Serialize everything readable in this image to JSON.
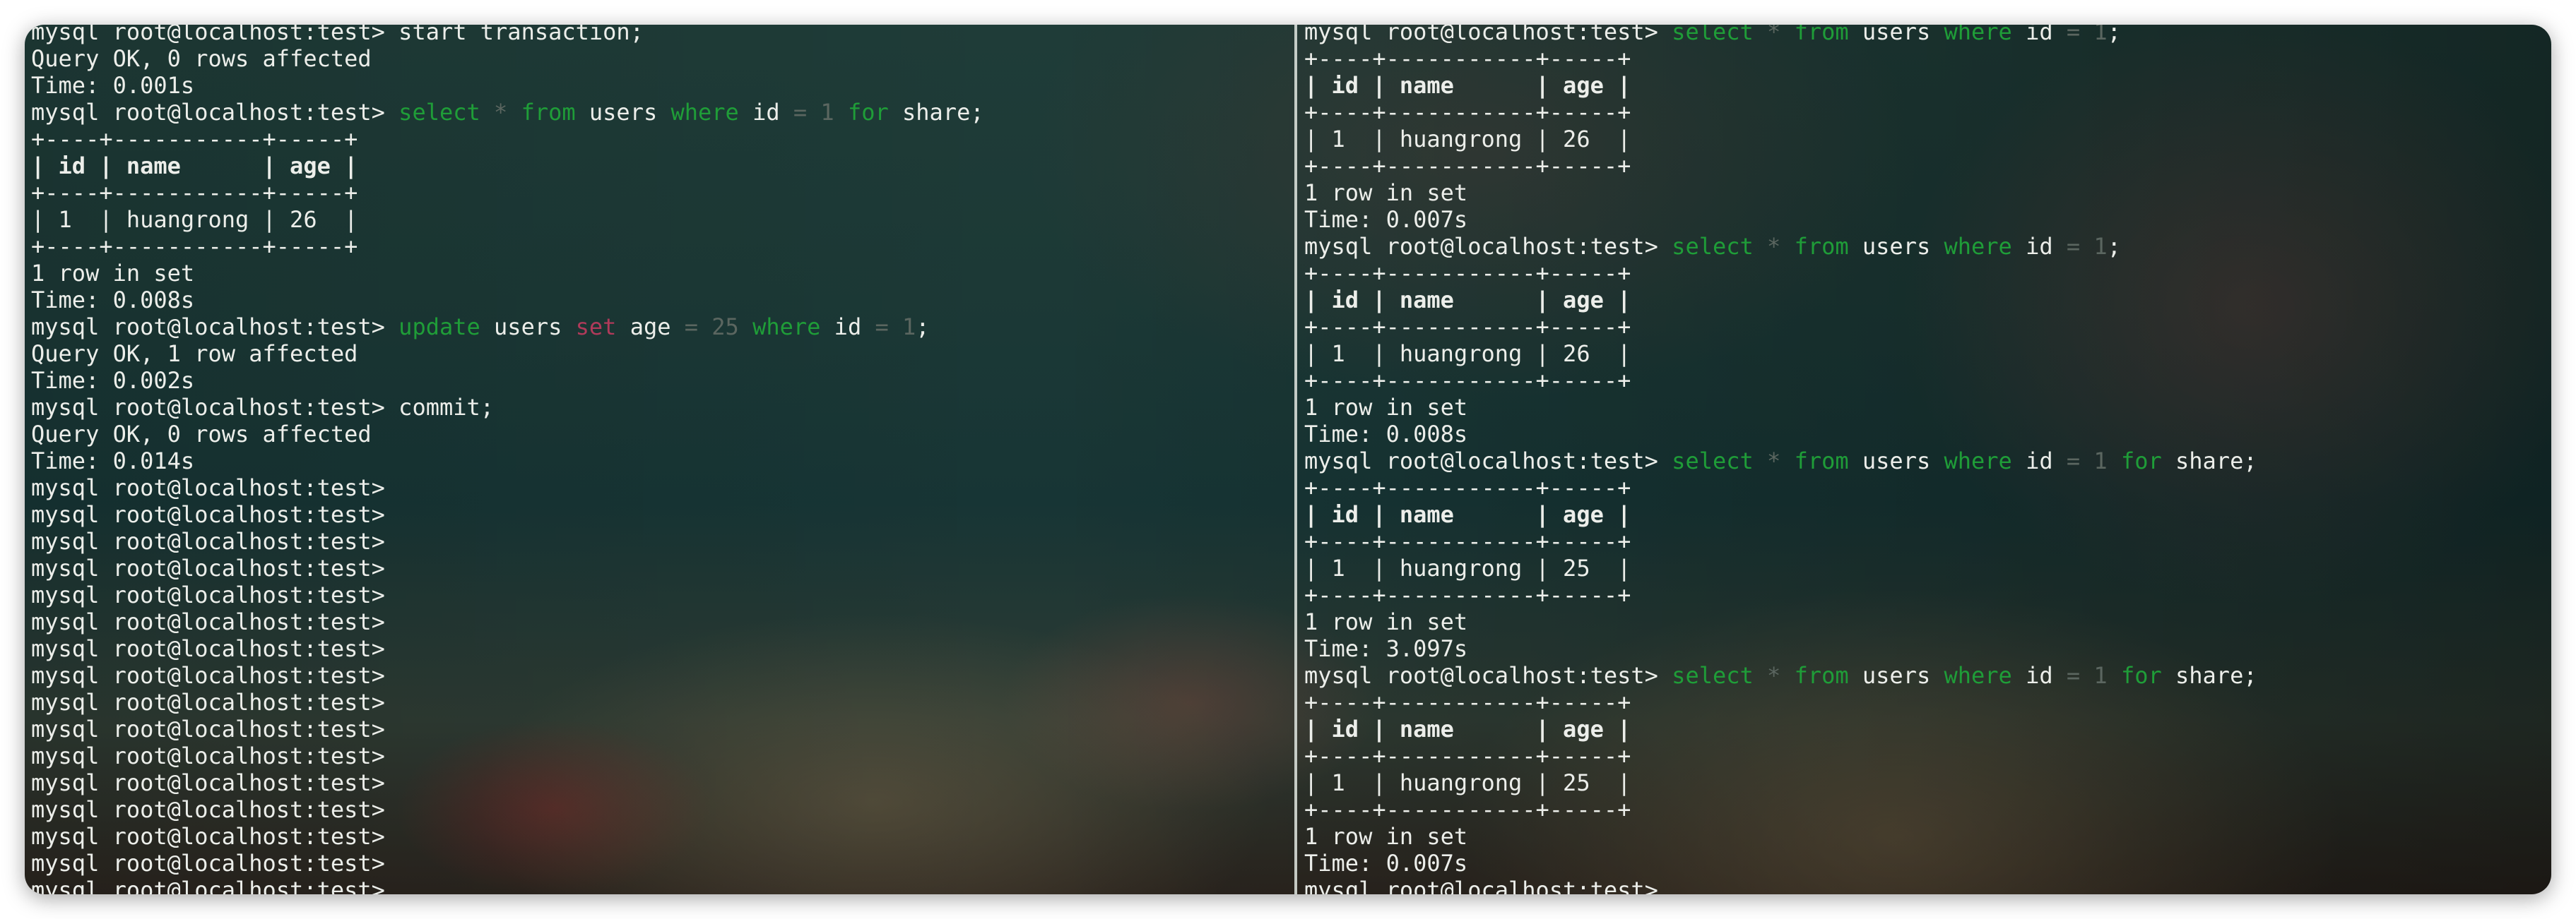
{
  "colors": {
    "keyword": "#1f9d38",
    "operator": "#5b6660",
    "set_keyword": "#b03a5a",
    "text": "#eceeea"
  },
  "left_pane": {
    "lines": [
      {
        "type": "cmd",
        "prompt": "mysql root@localhost:test> ",
        "tokens": [
          {
            "t": "start transaction;",
            "c": ""
          }
        ]
      },
      {
        "type": "out",
        "text": "Query OK, 0 rows affected"
      },
      {
        "type": "out",
        "text": "Time: 0.001s"
      },
      {
        "type": "cmd",
        "prompt": "mysql root@localhost:test> ",
        "tokens": [
          {
            "t": "select",
            "c": "kw"
          },
          {
            "t": " "
          },
          {
            "t": "*",
            "c": "op"
          },
          {
            "t": " "
          },
          {
            "t": "from",
            "c": "kw"
          },
          {
            "t": " users "
          },
          {
            "t": "where",
            "c": "kw"
          },
          {
            "t": " id "
          },
          {
            "t": "=",
            "c": "op"
          },
          {
            "t": " "
          },
          {
            "t": "1",
            "c": "num"
          },
          {
            "t": " "
          },
          {
            "t": "for",
            "c": "kw"
          },
          {
            "t": " share;"
          }
        ]
      },
      {
        "type": "sep",
        "text": "+----+-----------+-----+"
      },
      {
        "type": "hdr",
        "text": "| id | name      | age |"
      },
      {
        "type": "sep",
        "text": "+----+-----------+-----+"
      },
      {
        "type": "row",
        "text": "| 1  | huangrong | 26  |"
      },
      {
        "type": "sep",
        "text": "+----+-----------+-----+"
      },
      {
        "type": "out",
        "text": "1 row in set"
      },
      {
        "type": "out",
        "text": "Time: 0.008s"
      },
      {
        "type": "cmd",
        "prompt": "mysql root@localhost:test> ",
        "tokens": [
          {
            "t": "update",
            "c": "kw"
          },
          {
            "t": " users "
          },
          {
            "t": "set",
            "c": "bad"
          },
          {
            "t": " age "
          },
          {
            "t": "=",
            "c": "op"
          },
          {
            "t": " "
          },
          {
            "t": "25",
            "c": "num"
          },
          {
            "t": " "
          },
          {
            "t": "where",
            "c": "kw"
          },
          {
            "t": " id "
          },
          {
            "t": "=",
            "c": "op"
          },
          {
            "t": " "
          },
          {
            "t": "1",
            "c": "num"
          },
          {
            "t": ";"
          }
        ]
      },
      {
        "type": "out",
        "text": "Query OK, 1 row affected"
      },
      {
        "type": "out",
        "text": "Time: 0.002s"
      },
      {
        "type": "cmd",
        "prompt": "mysql root@localhost:test> ",
        "tokens": [
          {
            "t": "commit;",
            "c": ""
          }
        ]
      },
      {
        "type": "out",
        "text": "Query OK, 0 rows affected"
      },
      {
        "type": "out",
        "text": "Time: 0.014s"
      },
      {
        "type": "prompt",
        "text": "mysql root@localhost:test>"
      },
      {
        "type": "prompt",
        "text": "mysql root@localhost:test>"
      },
      {
        "type": "prompt",
        "text": "mysql root@localhost:test>"
      },
      {
        "type": "prompt",
        "text": "mysql root@localhost:test>"
      },
      {
        "type": "prompt",
        "text": "mysql root@localhost:test>"
      },
      {
        "type": "prompt",
        "text": "mysql root@localhost:test>"
      },
      {
        "type": "prompt",
        "text": "mysql root@localhost:test>"
      },
      {
        "type": "prompt",
        "text": "mysql root@localhost:test>"
      },
      {
        "type": "prompt",
        "text": "mysql root@localhost:test>"
      },
      {
        "type": "prompt",
        "text": "mysql root@localhost:test>"
      },
      {
        "type": "prompt",
        "text": "mysql root@localhost:test>"
      },
      {
        "type": "prompt",
        "text": "mysql root@localhost:test>"
      },
      {
        "type": "prompt",
        "text": "mysql root@localhost:test>"
      },
      {
        "type": "prompt",
        "text": "mysql root@localhost:test>"
      },
      {
        "type": "prompt",
        "text": "mysql root@localhost:test>"
      },
      {
        "type": "prompt",
        "text": "mysql root@localhost:test>"
      }
    ]
  },
  "right_pane": {
    "lines": [
      {
        "type": "cmd",
        "prompt": "mysql root@localhost:test> ",
        "tokens": [
          {
            "t": "select",
            "c": "kw"
          },
          {
            "t": " "
          },
          {
            "t": "*",
            "c": "op"
          },
          {
            "t": " "
          },
          {
            "t": "from",
            "c": "kw"
          },
          {
            "t": " users "
          },
          {
            "t": "where",
            "c": "kw"
          },
          {
            "t": " id "
          },
          {
            "t": "=",
            "c": "op"
          },
          {
            "t": " "
          },
          {
            "t": "1",
            "c": "num"
          },
          {
            "t": ";"
          }
        ]
      },
      {
        "type": "sep",
        "text": "+----+-----------+-----+"
      },
      {
        "type": "hdr",
        "text": "| id | name      | age |"
      },
      {
        "type": "sep",
        "text": "+----+-----------+-----+"
      },
      {
        "type": "row",
        "text": "| 1  | huangrong | 26  |"
      },
      {
        "type": "sep",
        "text": "+----+-----------+-----+"
      },
      {
        "type": "out",
        "text": "1 row in set"
      },
      {
        "type": "out",
        "text": "Time: 0.007s"
      },
      {
        "type": "cmd",
        "prompt": "mysql root@localhost:test> ",
        "tokens": [
          {
            "t": "select",
            "c": "kw"
          },
          {
            "t": " "
          },
          {
            "t": "*",
            "c": "op"
          },
          {
            "t": " "
          },
          {
            "t": "from",
            "c": "kw"
          },
          {
            "t": " users "
          },
          {
            "t": "where",
            "c": "kw"
          },
          {
            "t": " id "
          },
          {
            "t": "=",
            "c": "op"
          },
          {
            "t": " "
          },
          {
            "t": "1",
            "c": "num"
          },
          {
            "t": ";"
          }
        ]
      },
      {
        "type": "sep",
        "text": "+----+-----------+-----+"
      },
      {
        "type": "hdr",
        "text": "| id | name      | age |"
      },
      {
        "type": "sep",
        "text": "+----+-----------+-----+"
      },
      {
        "type": "row",
        "text": "| 1  | huangrong | 26  |"
      },
      {
        "type": "sep",
        "text": "+----+-----------+-----+"
      },
      {
        "type": "out",
        "text": "1 row in set"
      },
      {
        "type": "out",
        "text": "Time: 0.008s"
      },
      {
        "type": "cmd",
        "prompt": "mysql root@localhost:test> ",
        "tokens": [
          {
            "t": "select",
            "c": "kw"
          },
          {
            "t": " "
          },
          {
            "t": "*",
            "c": "op"
          },
          {
            "t": " "
          },
          {
            "t": "from",
            "c": "kw"
          },
          {
            "t": " users "
          },
          {
            "t": "where",
            "c": "kw"
          },
          {
            "t": " id "
          },
          {
            "t": "=",
            "c": "op"
          },
          {
            "t": " "
          },
          {
            "t": "1",
            "c": "num"
          },
          {
            "t": " "
          },
          {
            "t": "for",
            "c": "kw"
          },
          {
            "t": " share;"
          }
        ]
      },
      {
        "type": "sep",
        "text": "+----+-----------+-----+"
      },
      {
        "type": "hdr",
        "text": "| id | name      | age |"
      },
      {
        "type": "sep",
        "text": "+----+-----------+-----+"
      },
      {
        "type": "row",
        "text": "| 1  | huangrong | 25  |"
      },
      {
        "type": "sep",
        "text": "+----+-----------+-----+"
      },
      {
        "type": "out",
        "text": "1 row in set"
      },
      {
        "type": "out",
        "text": "Time: 3.097s"
      },
      {
        "type": "cmd",
        "prompt": "mysql root@localhost:test> ",
        "tokens": [
          {
            "t": "select",
            "c": "kw"
          },
          {
            "t": " "
          },
          {
            "t": "*",
            "c": "op"
          },
          {
            "t": " "
          },
          {
            "t": "from",
            "c": "kw"
          },
          {
            "t": " users "
          },
          {
            "t": "where",
            "c": "kw"
          },
          {
            "t": " id "
          },
          {
            "t": "=",
            "c": "op"
          },
          {
            "t": " "
          },
          {
            "t": "1",
            "c": "num"
          },
          {
            "t": " "
          },
          {
            "t": "for",
            "c": "kw"
          },
          {
            "t": " share;"
          }
        ]
      },
      {
        "type": "sep",
        "text": "+----+-----------+-----+"
      },
      {
        "type": "hdr",
        "text": "| id | name      | age |"
      },
      {
        "type": "sep",
        "text": "+----+-----------+-----+"
      },
      {
        "type": "row",
        "text": "| 1  | huangrong | 25  |"
      },
      {
        "type": "sep",
        "text": "+----+-----------+-----+"
      },
      {
        "type": "out",
        "text": "1 row in set"
      },
      {
        "type": "out",
        "text": "Time: 0.007s"
      },
      {
        "type": "prompt",
        "text": "mysql root@localhost:test>"
      }
    ]
  }
}
